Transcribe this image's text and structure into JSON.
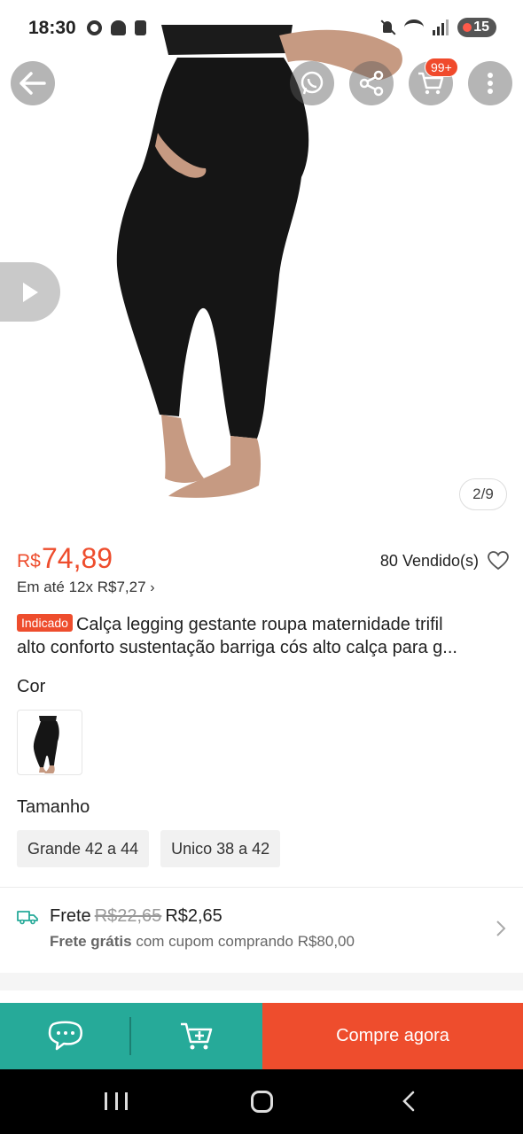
{
  "status_bar": {
    "time": "18:30",
    "battery": "15",
    "icons": [
      "chrome-icon",
      "bell-icon",
      "alert-icon",
      "mute-icon",
      "wifi-icon",
      "signal-icon"
    ]
  },
  "hero": {
    "cart_badge": "99+",
    "page_counter": "2/9",
    "icons": [
      "back-arrow-icon",
      "whatsapp-icon",
      "share-icon",
      "cart-icon",
      "more-vertical-icon",
      "play-icon"
    ]
  },
  "product": {
    "currency": "R$",
    "price": "74,89",
    "sold": "80 Vendido(s)",
    "installments": "Em até 12x R$7,27",
    "badge": "Indicado",
    "title_line1": "Calça legging gestante roupa maternidade trifil",
    "title_line2": "alto conforto sustentação barriga cós alto calça para g..."
  },
  "variants": {
    "color_label": "Cor",
    "size_label": "Tamanho",
    "sizes": [
      "Grande 42 a 44",
      "Unico 38 a 42"
    ]
  },
  "shipping": {
    "label": "Frete",
    "old_price": "R$22,65",
    "new_price": "R$2,65",
    "free_bold": "Frete grátis",
    "free_rest": "com cupom comprando R$80,00"
  },
  "actions": {
    "buy_now": "Compre agora"
  },
  "colors": {
    "brand": "#ee4d2d",
    "teal": "#26aa99"
  }
}
